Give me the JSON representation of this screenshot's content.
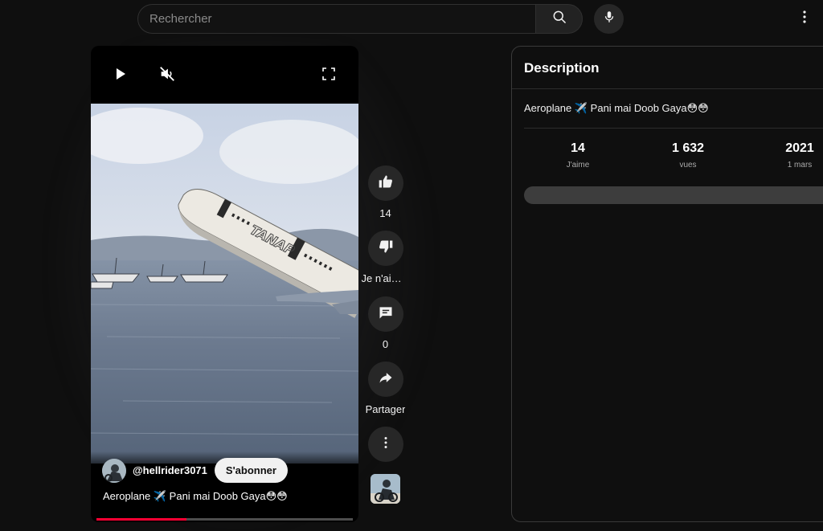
{
  "search": {
    "placeholder": "Rechercher"
  },
  "icons": {
    "search": "search-icon",
    "mic": "microphone-icon",
    "more": "more-vert-icon",
    "play": "play-icon",
    "mute": "volume-off-icon",
    "fullscreen": "fullscreen-icon",
    "like": "thumbs-up-icon",
    "dislike": "thumbs-down-icon",
    "comment": "comment-icon",
    "share": "share-icon"
  },
  "video": {
    "channel": "@hellrider3071",
    "subscribe_label": "S'abonner",
    "title": "Aeroplane ✈️ Pani mai Doob Gaya😳😳",
    "progress": 0.35,
    "plane_livery": "TANAP"
  },
  "actions": {
    "like_count": "14",
    "dislike_label": "Je n'aime pas",
    "comment_count": "0",
    "share_label": "Partager"
  },
  "description": {
    "header": "Description",
    "text": "Aeroplane ✈️ Pani mai Doob Gaya😳😳",
    "stats": [
      {
        "value": "14",
        "label": "J'aime"
      },
      {
        "value": "1 632",
        "label": "vues"
      },
      {
        "value": "2021",
        "label": "1 mars"
      }
    ]
  },
  "colors": {
    "background": "#0f0f0f",
    "accent_red": "#ff0033",
    "button_bg": "#272727"
  }
}
